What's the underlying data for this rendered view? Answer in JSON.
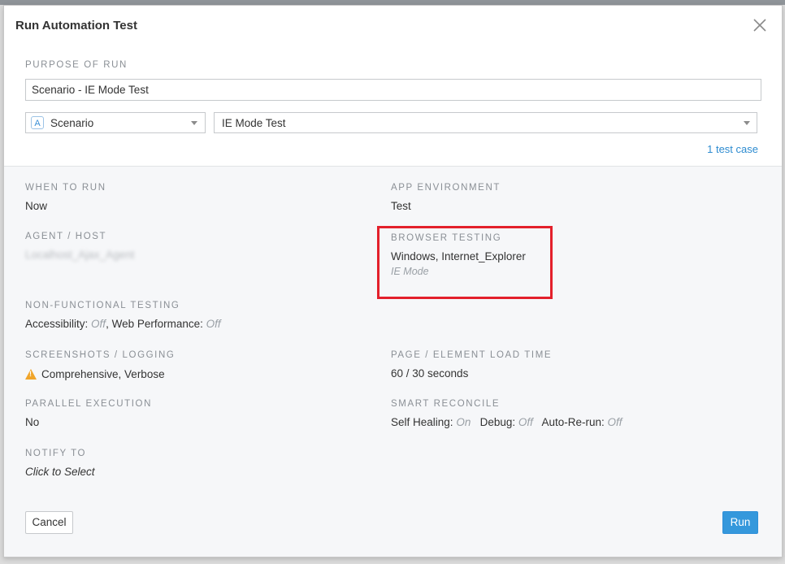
{
  "dialog": {
    "title": "Run Automation Test"
  },
  "purpose": {
    "label": "PURPOSE OF RUN",
    "value": "Scenario - IE Mode Test"
  },
  "type_select": {
    "badge": "A",
    "value": "Scenario"
  },
  "name_select": {
    "value": "IE Mode Test"
  },
  "test_count": "1 test case",
  "settings": {
    "when_to_run": {
      "label": "WHEN TO RUN",
      "value": "Now"
    },
    "app_environment": {
      "label": "APP ENVIRONMENT",
      "value": "Test"
    },
    "agent_host": {
      "label": "AGENT / HOST",
      "value": "Localhost_Ajax_Agent"
    },
    "browser_testing": {
      "label": "BROWSER TESTING",
      "value": "Windows, Internet_Explorer",
      "mode": "IE Mode"
    },
    "non_functional": {
      "label": "NON-FUNCTIONAL TESTING",
      "accessibility_label": "Accessibility:",
      "accessibility_value": "Off",
      "separator": ",",
      "web_perf_label": "Web Performance:",
      "web_perf_value": "Off"
    },
    "screenshots_logging": {
      "label": "SCREENSHOTS / LOGGING",
      "value": "Comprehensive, Verbose",
      "icon": "warning-icon"
    },
    "load_time": {
      "label": "PAGE / ELEMENT LOAD TIME",
      "value": "60 / 30 seconds"
    },
    "parallel_execution": {
      "label": "PARALLEL EXECUTION",
      "value": "No"
    },
    "smart_reconcile": {
      "label": "SMART RECONCILE",
      "self_healing_label": "Self Healing:",
      "self_healing_value": "On",
      "debug_label": "Debug:",
      "debug_value": "Off",
      "auto_rerun_label": "Auto-Re-run:",
      "auto_rerun_value": "Off"
    },
    "notify_to": {
      "label": "NOTIFY TO",
      "value": "Click to Select"
    }
  },
  "buttons": {
    "cancel": "Cancel",
    "run": "Run"
  },
  "colors": {
    "accent": "#3598dc",
    "highlight": "#e3202b",
    "warning": "#f0a52a"
  }
}
